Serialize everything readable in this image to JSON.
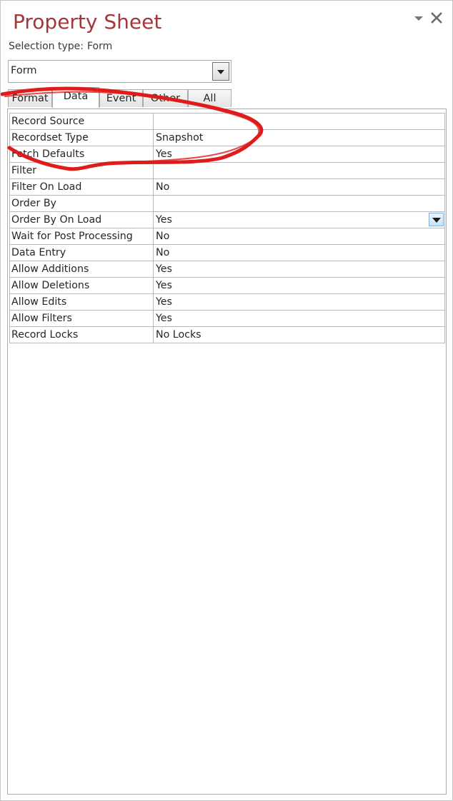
{
  "pane": {
    "title": "Property Sheet",
    "selection_label": "Selection type:",
    "selection_value": "Form",
    "object_combo_value": "Form",
    "menu_icon": "chevron-down-icon",
    "close_icon": "close-icon"
  },
  "tabs": [
    {
      "label": "Format",
      "active": false
    },
    {
      "label": "Data",
      "active": true
    },
    {
      "label": "Event",
      "active": false
    },
    {
      "label": "Other",
      "active": false
    },
    {
      "label": "All",
      "active": false
    }
  ],
  "properties": [
    {
      "name": "Record Source",
      "value": ""
    },
    {
      "name": "Recordset Type",
      "value": "Snapshot"
    },
    {
      "name": "Fetch Defaults",
      "value": "Yes"
    },
    {
      "name": "Filter",
      "value": ""
    },
    {
      "name": "Filter On Load",
      "value": "No"
    },
    {
      "name": "Order By",
      "value": ""
    },
    {
      "name": "Order By On Load",
      "value": "Yes"
    },
    {
      "name": "Wait for Post Processing",
      "value": "No"
    },
    {
      "name": "Data Entry",
      "value": "No"
    },
    {
      "name": "Allow Additions",
      "value": "Yes"
    },
    {
      "name": "Allow Deletions",
      "value": "Yes"
    },
    {
      "name": "Allow Edits",
      "value": "Yes"
    },
    {
      "name": "Allow Filters",
      "value": "Yes"
    },
    {
      "name": "Record Locks",
      "value": "No Locks"
    }
  ],
  "colors": {
    "title": "#a4373a",
    "annotation": "#e01b1b",
    "dropdown_accent": "#c8e3f8"
  }
}
